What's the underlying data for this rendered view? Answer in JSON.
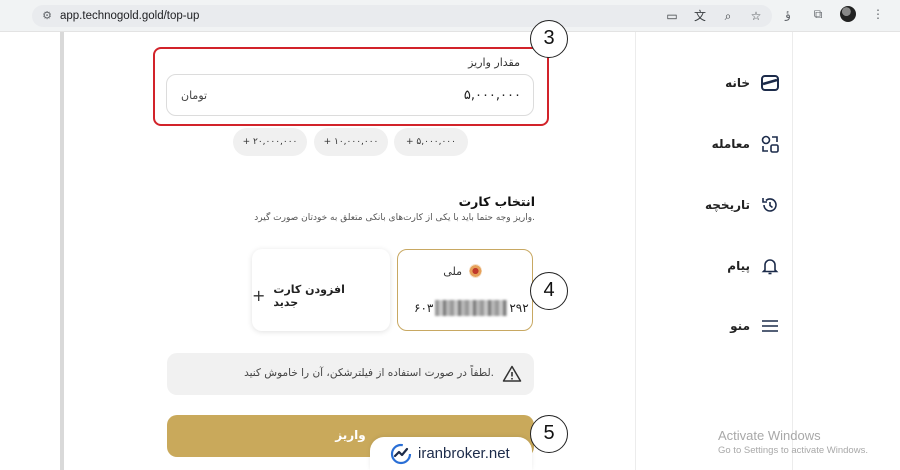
{
  "browser": {
    "url": "app.technogold.gold/top-up",
    "icons": [
      "site-settings-icon",
      "cast-icon",
      "translate-icon",
      "zoom-icon",
      "star-icon"
    ],
    "profile_glyph": "ؤ"
  },
  "nav": {
    "items": [
      {
        "label": "خانه",
        "icon": "home-icon"
      },
      {
        "label": "معامله",
        "icon": "trade-icon"
      },
      {
        "label": "تاریخچه",
        "icon": "history-icon"
      },
      {
        "label": "پیام",
        "icon": "bell-icon"
      },
      {
        "label": "منو",
        "icon": "menu-icon"
      }
    ]
  },
  "amount": {
    "label": "مقدار واریز",
    "value": "۵,۰۰۰,۰۰۰",
    "unit": "تومان"
  },
  "presets": [
    "+ ۲۰,۰۰۰,۰۰۰",
    "+ ۱۰,۰۰۰,۰۰۰",
    "+ ۵,۰۰۰,۰۰۰"
  ],
  "cards": {
    "title": "انتخاب کارت",
    "subtitle": "واریز وجه حتما باید با یکی از کارت‌های بانکی متعلق به خودتان صورت گیرد.",
    "bank_name": "ملی",
    "card_prefix": "۶۰۳",
    "card_suffix": "۲۹۲",
    "add_label": "افزودن کارت جدید"
  },
  "warning": {
    "text": "لطفاً در صورت استفاده از فیلترشکن، آن را خاموش کنید."
  },
  "deposit": {
    "label": "واریز"
  },
  "annotations": {
    "b3": "3",
    "b4": "4",
    "b5": "5"
  },
  "watermark": {
    "text": "iranbroker.net"
  },
  "windows": {
    "line1": "Activate Windows",
    "line2": "Go to Settings to activate Windows."
  },
  "colors": {
    "accent_gold": "#c9a95b",
    "highlight_red": "#d2232a",
    "card_border": "#c8a862"
  }
}
